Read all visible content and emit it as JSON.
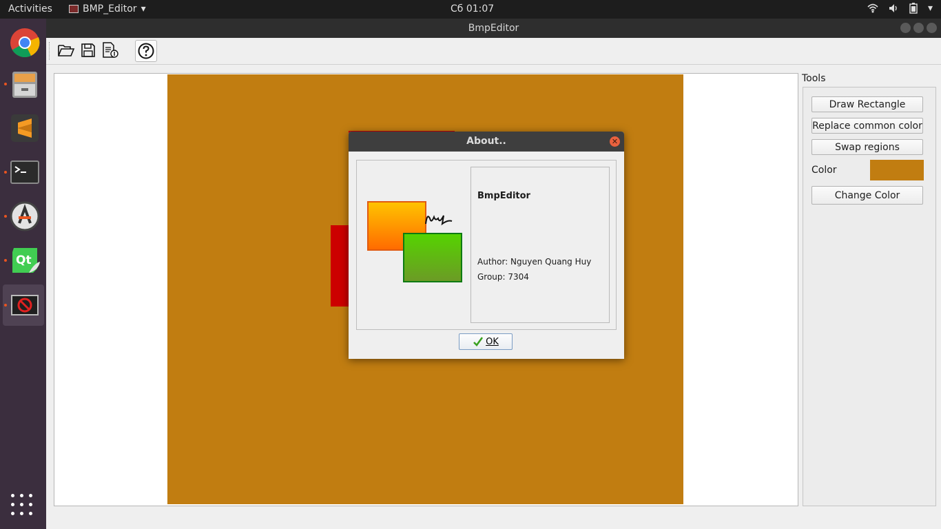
{
  "topbar": {
    "activities": "Activities",
    "app_menu_label": "BMP_Editor",
    "clock": "Сб 01:07",
    "tray_icons": [
      "wifi-icon",
      "volume-icon",
      "battery-icon",
      "chevron-down-icon"
    ]
  },
  "dock": {
    "items": [
      "chrome",
      "files",
      "sublime-text",
      "terminal",
      "software-updater",
      "qt-creator",
      "bmp-editor"
    ]
  },
  "window": {
    "title": "BmpEditor"
  },
  "toolbar": {
    "icons": [
      "open-folder-icon",
      "save-icon",
      "save-as-icon",
      "help-icon"
    ]
  },
  "tools": {
    "label": "Tools",
    "draw_rectangle": "Draw Rectangle",
    "replace_common_color": "Replace common color",
    "swap_regions": "Swap regions",
    "color_label": "Color",
    "current_color": "#c17d11",
    "change_color": "Change Color"
  },
  "canvas": {
    "fill_color": "#c17d11",
    "shape_color": "#cc0000"
  },
  "about": {
    "title": "About..",
    "app_name": "BmpEditor",
    "author": "Author: Nguyen Quang Huy",
    "group": "Group: 7304",
    "ok": "OK"
  }
}
